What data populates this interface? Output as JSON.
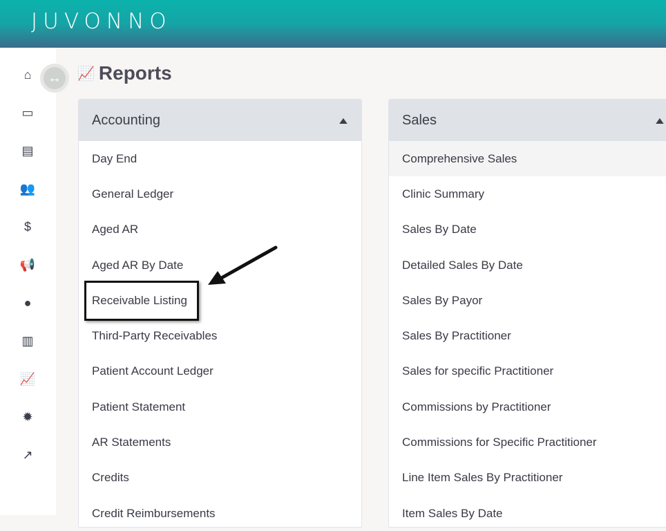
{
  "brand": {
    "logo": "JUVONNO"
  },
  "sidebar": {
    "items": [
      {
        "icon": "home-icon",
        "glyph": "⌂"
      },
      {
        "icon": "monitor-icon",
        "glyph": "▭"
      },
      {
        "icon": "clipboard-icon",
        "glyph": "▤"
      },
      {
        "icon": "users-icon",
        "glyph": "👥"
      },
      {
        "icon": "dollar-icon",
        "glyph": "$"
      },
      {
        "icon": "megaphone-icon",
        "glyph": "📢"
      },
      {
        "icon": "chat-bubble-icon",
        "glyph": "●"
      },
      {
        "icon": "document-icon",
        "glyph": "▥"
      },
      {
        "icon": "chart-icon",
        "glyph": "📈"
      },
      {
        "icon": "gear-icon",
        "glyph": "✹"
      },
      {
        "icon": "external-link-icon",
        "glyph": "↗"
      }
    ],
    "toggle_icon": "arrows-horizontal-icon"
  },
  "page": {
    "title": "Reports",
    "title_icon": "line-chart-icon"
  },
  "panels": [
    {
      "title": "Accounting",
      "items": [
        "Day End",
        "General Ledger",
        "Aged AR",
        "Aged AR By Date",
        "Receivable Listing",
        "Third-Party Receivables",
        "Patient Account Ledger",
        "Patient Statement",
        "AR Statements",
        "Credits",
        "Credit Reimbursements"
      ]
    },
    {
      "title": "Sales",
      "items": [
        "Comprehensive Sales",
        "Clinic Summary",
        "Sales By Date",
        "Detailed Sales By Date",
        "Sales By Payor",
        "Sales By Practitioner",
        "Sales for specific Practitioner",
        "Commissions by Practitioner",
        "Commissions for Specific Practitioner",
        "Line Item Sales By Practitioner",
        "Item Sales By Date"
      ]
    }
  ],
  "annotation": {
    "highlighted_item": "Receivable Listing"
  }
}
